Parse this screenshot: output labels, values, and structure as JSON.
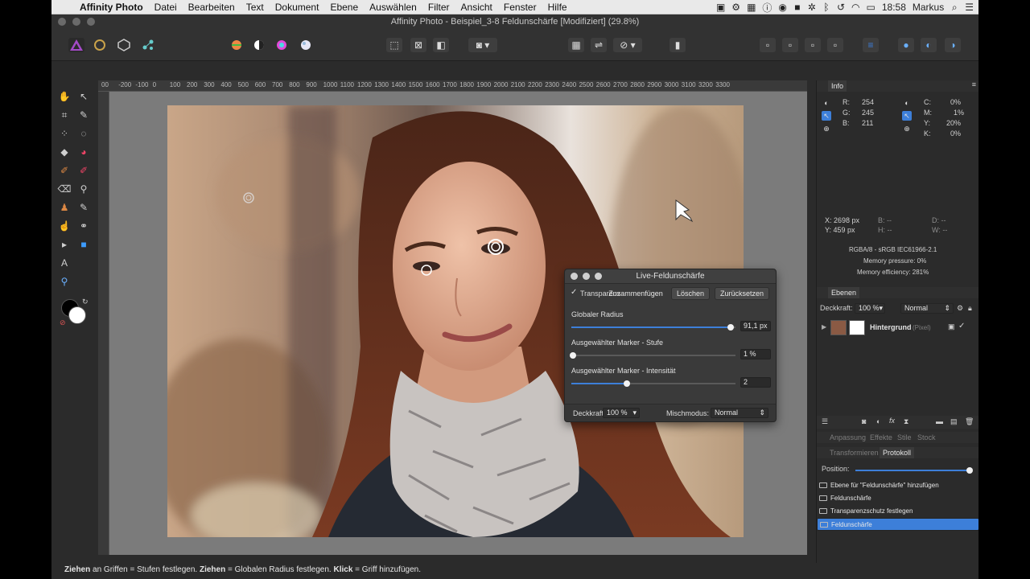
{
  "menubar": {
    "items": [
      "Affinity Photo",
      "Datei",
      "Bearbeiten",
      "Text",
      "Dokument",
      "Ebene",
      "Auswählen",
      "Filter",
      "Ansicht",
      "Fenster",
      "Hilfe"
    ],
    "time": "18:58",
    "user": "Markus"
  },
  "window": {
    "title": "Affinity Photo - Beispiel_3-8 Feldunschärfe [Modifiziert] (29.8%)"
  },
  "ruler": {
    "labels": [
      "00",
      "-200",
      "-100",
      "0",
      "100",
      "200",
      "300",
      "400",
      "500",
      "600",
      "700",
      "800",
      "900",
      "1000",
      "1100",
      "1200",
      "1300",
      "1400",
      "1500",
      "1600",
      "1700",
      "1800",
      "1900",
      "2000",
      "2100",
      "2200",
      "2300",
      "2400",
      "2500",
      "2600",
      "2700",
      "2800",
      "2900",
      "3000",
      "3100",
      "3200",
      "3300"
    ]
  },
  "status": {
    "t1": "Ziehen",
    "t2": " an Griffen = Stufen festlegen. ",
    "t3": "Ziehen",
    "t4": " = Globalen Radius festlegen. ",
    "t5": "Klick",
    "t6": " = Griff hinzufügen."
  },
  "dialog": {
    "title": "Live-Feldunschärfe",
    "check_mark": "✓",
    "transparency_label": "Transparenz",
    "merge_button": "Zusammenfügen",
    "delete_button": "Löschen",
    "reset_button": "Zurücksetzen",
    "global_radius_label": "Globaler Radius",
    "global_radius_value": "91,1 px",
    "global_radius_level": 0.97,
    "marker_level_label": "Ausgewählter Marker - Stufe",
    "marker_level_value": "1 %",
    "marker_level_level": 0.01,
    "marker_intensity_label": "Ausgewählter Marker - Intensität",
    "marker_intensity_value": "2",
    "marker_intensity_level": 0.34,
    "opacity_label": "Deckkraft:",
    "opacity_value": "100 %",
    "blend_label": "Mischmodus:",
    "blend_value": "Normal"
  },
  "info": {
    "tab": "Info",
    "r_label": "R:",
    "r": "254",
    "g_label": "G:",
    "g": "245",
    "b_label": "B:",
    "b": "211",
    "c_label": "C:",
    "c": "0%",
    "m_label": "M:",
    "m": "1%",
    "y_label": "Y:",
    "y": "20%",
    "k_label": "K:",
    "k": "0%",
    "x_pos": "X: 2698 px",
    "y_pos": "Y: 459 px",
    "b_dash": "B: --",
    "h_dash": "H: --",
    "d_dash": "D: --",
    "w_dash": "W: --",
    "profile": "RGBA/8 - sRGB IEC61966-2.1",
    "mem_pressure": "Memory pressure: 0%",
    "mem_eff": "Memory efficiency: 281%"
  },
  "layers": {
    "tab": "Ebenen",
    "opacity_label": "Deckkraft:",
    "opacity": "100 %",
    "blend": "Normal",
    "layer_name": "Hintergrund",
    "layer_type": "(Pixel)"
  },
  "adjust_tabs": [
    "Anpassung",
    "Effekte",
    "Stile",
    "Stock"
  ],
  "history": {
    "tabs": [
      "Transformieren",
      "Protokoll"
    ],
    "position_label": "Position:",
    "position_level": 1.0,
    "items": [
      "Ebene für \"Feldunschärfe\" hinzufügen",
      "Feldunschärfe",
      "Transparenzschutz festlegen",
      "Feldunschärfe"
    ]
  },
  "colors": {
    "accent": "#3d7fd9",
    "panel_bg": "#2b2b2b",
    "canvas_bg": "#7b7b7b"
  }
}
